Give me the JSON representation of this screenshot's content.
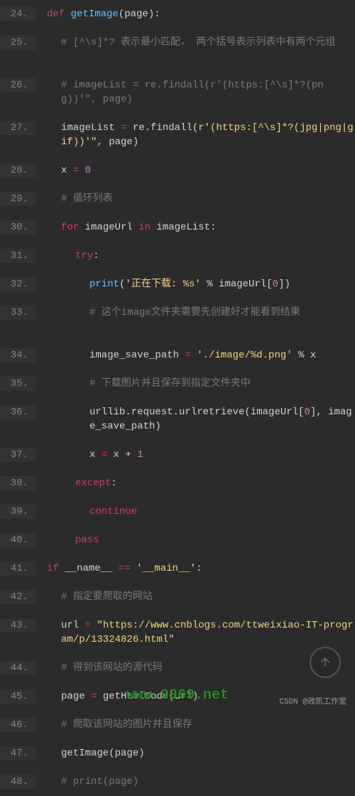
{
  "lines": [
    {
      "num": "24.",
      "indent": "",
      "tokens": [
        {
          "t": "def ",
          "c": "kw"
        },
        {
          "t": "getImage",
          "c": "fn"
        },
        {
          "t": "(page):",
          "c": "var"
        }
      ]
    },
    {
      "num": "25.",
      "indent": "i1",
      "wrap": true,
      "tokens": [
        {
          "t": "# [^\\s]*? 表示最小匹配， 两个括号表示列表中有两个元组",
          "c": "com"
        }
      ]
    },
    {
      "num": "26.",
      "indent": "i1",
      "wrap": true,
      "tokens": [
        {
          "t": "# imageList = re.findall(r'(https:[^\\s]*?(png))'\", page)",
          "c": "com"
        }
      ]
    },
    {
      "num": "27.",
      "indent": "i1",
      "wrap": true,
      "tokens": [
        {
          "t": "imageList ",
          "c": "var"
        },
        {
          "t": "= ",
          "c": "op"
        },
        {
          "t": "re.findall(",
          "c": "var"
        },
        {
          "t": "r'(https:[^\\s]*?(jpg|png|gif))'\"",
          "c": "str"
        },
        {
          "t": ", page)",
          "c": "var"
        }
      ]
    },
    {
      "num": "28.",
      "indent": "i1",
      "tokens": [
        {
          "t": "x ",
          "c": "var"
        },
        {
          "t": "= ",
          "c": "op"
        },
        {
          "t": "0",
          "c": "num"
        }
      ]
    },
    {
      "num": "29.",
      "indent": "i1",
      "tokens": [
        {
          "t": "# 循环列表",
          "c": "com"
        }
      ]
    },
    {
      "num": "30.",
      "indent": "i1",
      "tokens": [
        {
          "t": "for ",
          "c": "kw"
        },
        {
          "t": "imageUrl ",
          "c": "var"
        },
        {
          "t": "in ",
          "c": "kw"
        },
        {
          "t": "imageList:",
          "c": "var"
        }
      ]
    },
    {
      "num": "31.",
      "indent": "i2",
      "tokens": [
        {
          "t": "try",
          "c": "kw"
        },
        {
          "t": ":",
          "c": "var"
        }
      ]
    },
    {
      "num": "32.",
      "indent": "i3",
      "tokens": [
        {
          "t": "print",
          "c": "fn"
        },
        {
          "t": "(",
          "c": "var"
        },
        {
          "t": "'正在下载: %s'",
          "c": "str"
        },
        {
          "t": " % imageUrl[",
          "c": "var"
        },
        {
          "t": "0",
          "c": "num"
        },
        {
          "t": "])",
          "c": "var"
        }
      ]
    },
    {
      "num": "33.",
      "indent": "i3",
      "wrap": true,
      "tokens": [
        {
          "t": "# 这个image文件夹需要先创建好才能看到结果",
          "c": "com"
        }
      ]
    },
    {
      "num": "34.",
      "indent": "i3",
      "tokens": [
        {
          "t": "image_save_path ",
          "c": "var"
        },
        {
          "t": "= ",
          "c": "op"
        },
        {
          "t": "'./image/%d.png'",
          "c": "str"
        },
        {
          "t": " % x",
          "c": "var"
        }
      ]
    },
    {
      "num": "35.",
      "indent": "i3",
      "tokens": [
        {
          "t": "# 下载图片并且保存到指定文件夹中",
          "c": "com"
        }
      ]
    },
    {
      "num": "36.",
      "indent": "i3",
      "wrap": true,
      "tokens": [
        {
          "t": "urllib.request.urlretrieve(imageUrl[",
          "c": "var"
        },
        {
          "t": "0",
          "c": "num"
        },
        {
          "t": "], image_save_path)",
          "c": "var"
        }
      ]
    },
    {
      "num": "37.",
      "indent": "i3",
      "tokens": [
        {
          "t": "x ",
          "c": "var"
        },
        {
          "t": "= ",
          "c": "op"
        },
        {
          "t": "x + ",
          "c": "var"
        },
        {
          "t": "1",
          "c": "num"
        }
      ]
    },
    {
      "num": "38.",
      "indent": "i2",
      "tokens": [
        {
          "t": "except",
          "c": "kw"
        },
        {
          "t": ":",
          "c": "var"
        }
      ]
    },
    {
      "num": "39.",
      "indent": "i3",
      "tokens": [
        {
          "t": "continue",
          "c": "kw"
        }
      ]
    },
    {
      "num": "40.",
      "indent": "i2",
      "tokens": [
        {
          "t": "pass",
          "c": "kw"
        }
      ]
    },
    {
      "num": "41.",
      "indent": "",
      "tokens": [
        {
          "t": "if ",
          "c": "kw"
        },
        {
          "t": "__name__ ",
          "c": "var"
        },
        {
          "t": "== ",
          "c": "op"
        },
        {
          "t": "'__main__'",
          "c": "str"
        },
        {
          "t": ":",
          "c": "var"
        }
      ]
    },
    {
      "num": "42.",
      "indent": "i1",
      "tokens": [
        {
          "t": "# 指定要爬取的网站",
          "c": "com"
        }
      ]
    },
    {
      "num": "43.",
      "indent": "i1",
      "wrap": true,
      "tokens": [
        {
          "t": "url ",
          "c": "var"
        },
        {
          "t": "= ",
          "c": "op"
        },
        {
          "t": "\"https://www.cnblogs.com/ttweixiao-IT-program/p/13324826.html\"",
          "c": "str"
        }
      ]
    },
    {
      "num": "44.",
      "indent": "i1",
      "tokens": [
        {
          "t": "# 得到该网站的源代码",
          "c": "com"
        }
      ]
    },
    {
      "num": "45.",
      "indent": "i1",
      "tokens": [
        {
          "t": "page ",
          "c": "var"
        },
        {
          "t": "= ",
          "c": "op"
        },
        {
          "t": "getHtmlCode(url)",
          "c": "var"
        }
      ]
    },
    {
      "num": "46.",
      "indent": "i1",
      "tokens": [
        {
          "t": "# 爬取该网站的图片并且保存",
          "c": "com"
        }
      ]
    },
    {
      "num": "47.",
      "indent": "i1",
      "tokens": [
        {
          "t": "getImage(page)",
          "c": "var"
        }
      ]
    },
    {
      "num": "48.",
      "indent": "i1",
      "tokens": [
        {
          "t": "# print(page)",
          "c": "com"
        }
      ]
    }
  ],
  "watermark_right": "CSDN @政凯工作室",
  "watermark_center": "www.9969.net"
}
